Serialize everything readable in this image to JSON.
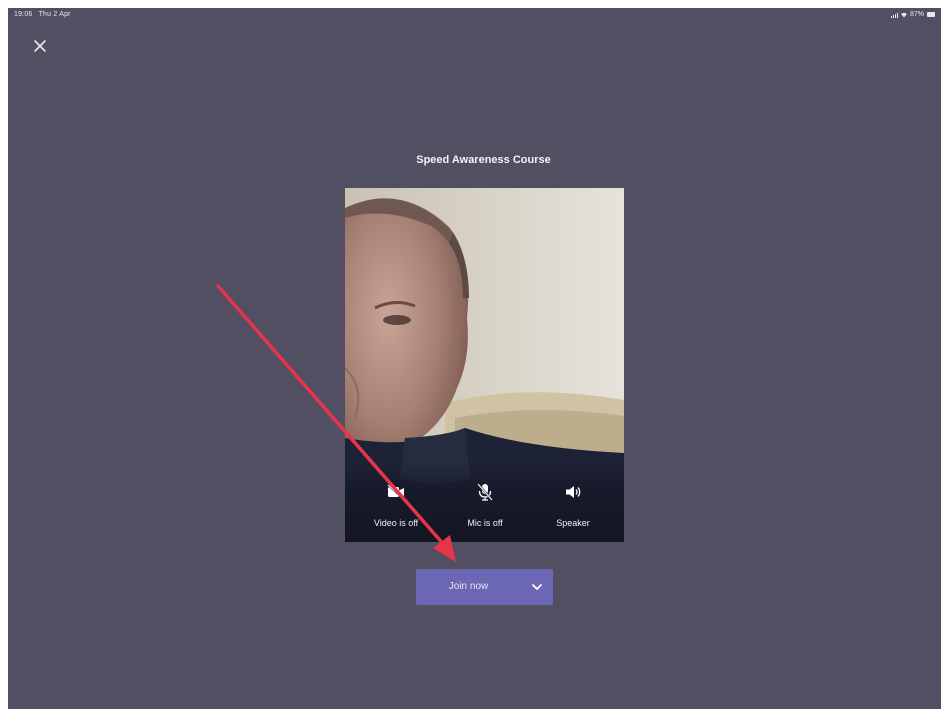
{
  "status_bar": {
    "time": "19:06",
    "date": "Thu 2 Apr",
    "battery": "87%"
  },
  "meeting": {
    "title": "Speed Awareness Course"
  },
  "controls": {
    "video_label": "Video is off",
    "mic_label": "Mic is off",
    "speaker_label": "Speaker"
  },
  "join": {
    "label": "Join now"
  },
  "colors": {
    "background": "#514f61",
    "join_button": "#6b67b3",
    "annotation_arrow": "#e8344a"
  },
  "icons": {
    "close": "close-icon",
    "video": "video-off-icon",
    "mic": "mic-off-icon",
    "speaker": "speaker-icon",
    "dropdown": "chevron-down-icon"
  }
}
